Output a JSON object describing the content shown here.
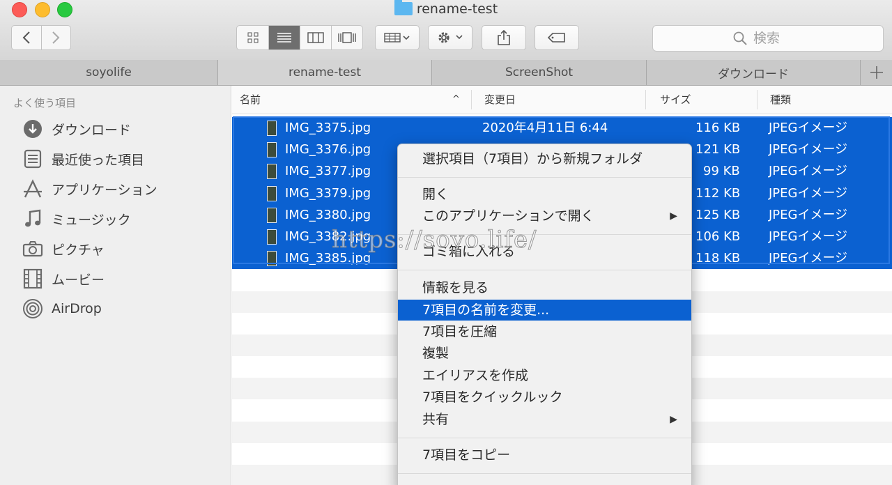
{
  "window": {
    "title": "rename-test"
  },
  "toolbar": {
    "view_icons": "icon-view-icon",
    "view_list": "list-view-icon",
    "view_columns": "column-view-icon",
    "view_coverflow": "coverflow-view-icon",
    "arrange": "arrange-icon",
    "action": "gear-icon",
    "share": "share-icon",
    "tags": "tag-icon"
  },
  "search": {
    "placeholder": "検索"
  },
  "tabs": [
    {
      "label": "soyolife"
    },
    {
      "label": "rename-test"
    },
    {
      "label": "ScreenShot"
    },
    {
      "label": "ダウンロード"
    }
  ],
  "sidebar": {
    "heading": "よく使う項目",
    "items": [
      {
        "label": "ダウンロード",
        "icon": "download-icon"
      },
      {
        "label": "最近使った項目",
        "icon": "recent-icon"
      },
      {
        "label": "アプリケーション",
        "icon": "applications-icon"
      },
      {
        "label": "ミュージック",
        "icon": "music-icon"
      },
      {
        "label": "ピクチャ",
        "icon": "camera-icon"
      },
      {
        "label": "ムービー",
        "icon": "movie-icon"
      },
      {
        "label": "AirDrop",
        "icon": "airdrop-icon"
      }
    ]
  },
  "columns": {
    "name": "名前",
    "date": "変更日",
    "size": "サイズ",
    "kind": "種類",
    "sort_indicator": "^"
  },
  "files": [
    {
      "name": "IMG_3375.jpg",
      "date": "2020年4月11日 6:44",
      "size": "116 KB",
      "kind": "JPEGイメージ"
    },
    {
      "name": "IMG_3376.jpg",
      "date": "",
      "size": "121 KB",
      "kind": "JPEGイメージ"
    },
    {
      "name": "IMG_3377.jpg",
      "date": "",
      "size": "99 KB",
      "kind": "JPEGイメージ"
    },
    {
      "name": "IMG_3379.jpg",
      "date": "",
      "size": "112 KB",
      "kind": "JPEGイメージ"
    },
    {
      "name": "IMG_3380.jpg",
      "date": "",
      "size": "125 KB",
      "kind": "JPEGイメージ"
    },
    {
      "name": "IMG_3382.jpg",
      "date": "",
      "size": "106 KB",
      "kind": "JPEGイメージ"
    },
    {
      "name": "IMG_3385.jpg",
      "date": "",
      "size": "118 KB",
      "kind": "JPEGイメージ"
    }
  ],
  "context_menu": {
    "new_folder": "選択項目（7項目）から新規フォルダ",
    "open": "開く",
    "open_with": "このアプリケーションで開く",
    "trash": "ゴミ箱に入れる",
    "get_info": "情報を見る",
    "rename": "7項目の名前を変更...",
    "compress": "7項目を圧縮",
    "duplicate": "複製",
    "alias": "エイリアスを作成",
    "quicklook": "7項目をクイックルック",
    "share": "共有",
    "copy": "7項目をコピー",
    "submenu_arrow": "▶"
  },
  "watermark": "https://soyo.life/",
  "colors": {
    "selection": "#0b61d1",
    "folder": "#5cb7f0"
  }
}
